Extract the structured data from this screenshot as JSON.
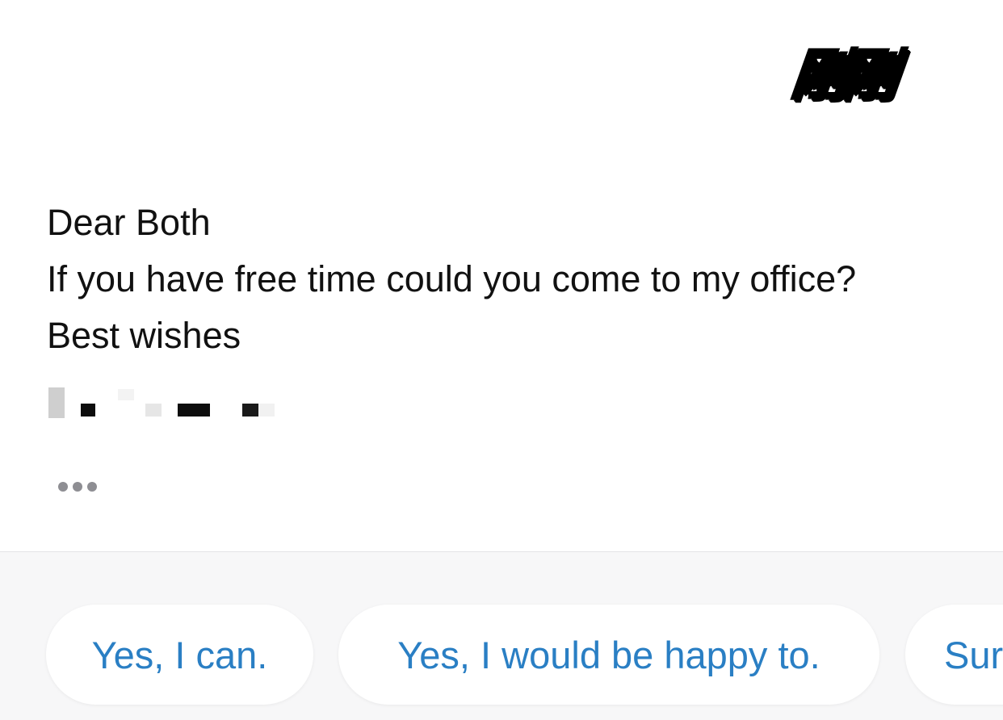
{
  "sticker": {
    "text": "刚刚"
  },
  "message": {
    "greeting": "Dear Both",
    "body": "If you have free time could you come to my office?",
    "closing": "Best wishes"
  },
  "smart_replies": [
    {
      "label": "Yes, I can."
    },
    {
      "label": "Yes, I would be happy to."
    },
    {
      "label": "Sur"
    }
  ],
  "colors": {
    "reply_text": "#2a7fc4",
    "body_text": "#111111",
    "tray_background": "#f7f7f8",
    "dots": "#8e8e93"
  },
  "icons": {
    "more": "ellipsis-icon"
  }
}
